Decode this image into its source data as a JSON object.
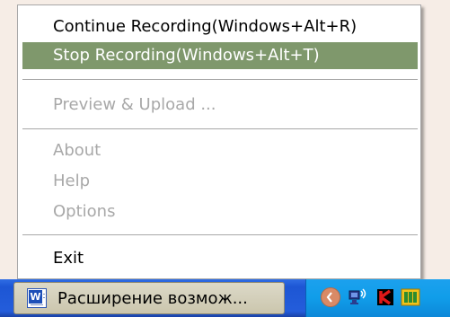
{
  "context_menu": {
    "items": [
      {
        "label": "Continue Recording(Windows+Alt+R)",
        "state": "enabled"
      },
      {
        "label": "Stop Recording(Windows+Alt+T)",
        "state": "highlighted"
      },
      {
        "label": "Preview & Upload ...",
        "state": "disabled"
      },
      {
        "label": "About",
        "state": "disabled"
      },
      {
        "label": "Help",
        "state": "disabled"
      },
      {
        "label": "Options",
        "state": "disabled"
      },
      {
        "label": "Exit",
        "state": "enabled"
      }
    ]
  },
  "taskbar": {
    "task_button": {
      "label": "Расширение возмож...",
      "icon": "word-document-icon"
    },
    "tray_icons": [
      "show-hidden-icons-chevron-icon",
      "network-icon",
      "kaspersky-icon",
      "app-tray-icon"
    ]
  },
  "colors": {
    "highlight": "#7f986c",
    "disabled_text": "#a8a8a8",
    "menu_background": "#ffffff",
    "taskbar_blue": "#245ddb",
    "tray_blue": "#109de9"
  }
}
